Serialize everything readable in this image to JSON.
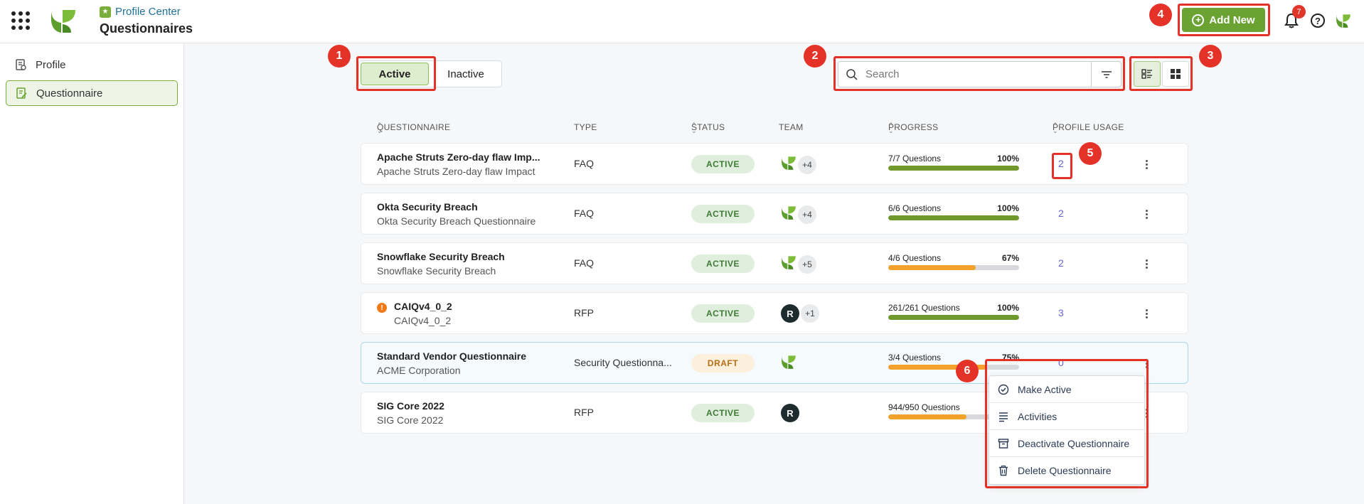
{
  "header": {
    "breadcrumb": "Profile Center",
    "title": "Questionnaires",
    "add_new_label": "Add New",
    "notification_count": "7",
    "help_label": "?"
  },
  "sidebar": {
    "items": [
      {
        "label": "Profile",
        "icon": "profile-doc-icon",
        "active": false
      },
      {
        "label": "Questionnaire",
        "icon": "questionnaire-edit-icon",
        "active": true
      }
    ]
  },
  "filters": {
    "tabs": [
      {
        "label": "Active",
        "selected": true
      },
      {
        "label": "Inactive",
        "selected": false
      }
    ],
    "search_placeholder": "Search",
    "view_modes": [
      "list-view-icon",
      "grid-view-icon"
    ],
    "selected_view": "list"
  },
  "table": {
    "columns": {
      "questionnaire": "QUESTIONNAIRE",
      "type": "TYPE",
      "status": "STATUS",
      "team": "TEAM",
      "progress": "PROGRESS",
      "profile_usage": "PROFILE USAGE"
    },
    "rows": [
      {
        "name": "Apache Struts Zero-day flaw Imp...",
        "sub": "Apache Struts Zero-day flaw Impact",
        "type": "FAQ",
        "status": "ACTIVE",
        "team_logo": "leaf",
        "team_more": "+4",
        "progress_text": "7/7 Questions",
        "progress_pct": "100%",
        "progress_value": 100,
        "usage": "2",
        "warning": false
      },
      {
        "name": "Okta Security Breach",
        "sub": "Okta Security Breach Questionnaire",
        "type": "FAQ",
        "status": "ACTIVE",
        "team_logo": "leaf",
        "team_more": "+4",
        "progress_text": "6/6 Questions",
        "progress_pct": "100%",
        "progress_value": 100,
        "usage": "2",
        "warning": false
      },
      {
        "name": "Snowflake Security Breach",
        "sub": "Snowflake Security Breach",
        "type": "FAQ",
        "status": "ACTIVE",
        "team_logo": "leaf",
        "team_more": "+5",
        "progress_text": "4/6 Questions",
        "progress_pct": "67%",
        "progress_value": 67,
        "usage": "2",
        "warning": false
      },
      {
        "name": "CAIQv4_0_2",
        "sub": "CAIQv4_0_2",
        "type": "RFP",
        "status": "ACTIVE",
        "team_logo": "dark",
        "team_more": "+1",
        "progress_text": "261/261 Questions",
        "progress_pct": "100%",
        "progress_value": 100,
        "usage": "3",
        "warning": true
      },
      {
        "name": "Standard Vendor Questionnaire",
        "sub": "ACME Corporation",
        "type": "Security Questionna...",
        "status": "DRAFT",
        "team_logo": "leaf",
        "team_more": "",
        "progress_text": "3/4 Questions",
        "progress_pct": "75%",
        "progress_value": 75,
        "usage": "0",
        "warning": false
      },
      {
        "name": "SIG Core 2022",
        "sub": "SIG Core 2022",
        "type": "RFP",
        "status": "ACTIVE",
        "team_logo": "dark",
        "team_more": "",
        "progress_text": "944/950 Questions",
        "progress_pct": "",
        "progress_value": 60,
        "usage": "",
        "warning": false
      }
    ]
  },
  "context_menu": {
    "items": [
      {
        "label": "Make Active",
        "icon": "check-circle-icon"
      },
      {
        "label": "Activities",
        "icon": "list-lines-icon"
      },
      {
        "label": "Deactivate Questionnaire",
        "icon": "archive-icon"
      },
      {
        "label": "Delete Questionnaire",
        "icon": "trash-icon"
      }
    ]
  },
  "callouts": [
    "1",
    "2",
    "3",
    "4",
    "5",
    "6"
  ],
  "colors": {
    "brand_green": "#6aa332",
    "bar_green": "#6f9a2b",
    "bar_orange": "#f2a22b",
    "annotation_red": "#e53228",
    "usage_purple": "#6b63d9"
  }
}
